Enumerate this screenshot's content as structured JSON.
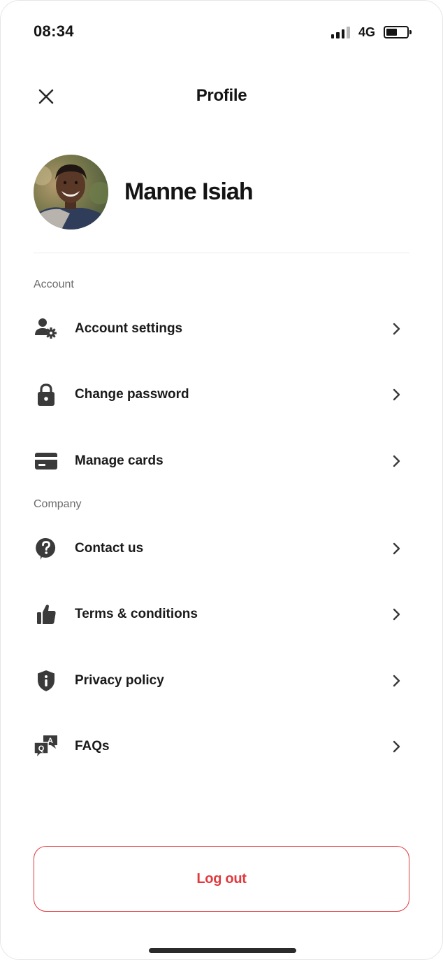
{
  "status_bar": {
    "time": "08:34",
    "network": "4G",
    "battery_level": 0.55
  },
  "header": {
    "title": "Profile",
    "close_icon": "close-icon"
  },
  "profile": {
    "name": "Manne Isiah",
    "avatar_icon": "avatar"
  },
  "sections": {
    "account": {
      "label": "Account",
      "items": [
        {
          "label": "Account settings",
          "icon": "user-settings-icon"
        },
        {
          "label": "Change password",
          "icon": "lock-icon"
        },
        {
          "label": "Manage cards",
          "icon": "credit-card-icon"
        }
      ]
    },
    "company": {
      "label": "Company",
      "items": [
        {
          "label": "Contact us",
          "icon": "help-bubble-icon"
        },
        {
          "label": "Terms & conditions",
          "icon": "thumbs-up-icon"
        },
        {
          "label": "Privacy policy",
          "icon": "shield-info-icon"
        },
        {
          "label": "FAQs",
          "icon": "qa-bubbles-icon"
        }
      ]
    }
  },
  "logout": {
    "label": "Log out"
  },
  "colors": {
    "accent": "#e03a3e",
    "text": "#1a1a1a",
    "muted": "#6b6b6b",
    "icon": "#3a3a3a"
  }
}
